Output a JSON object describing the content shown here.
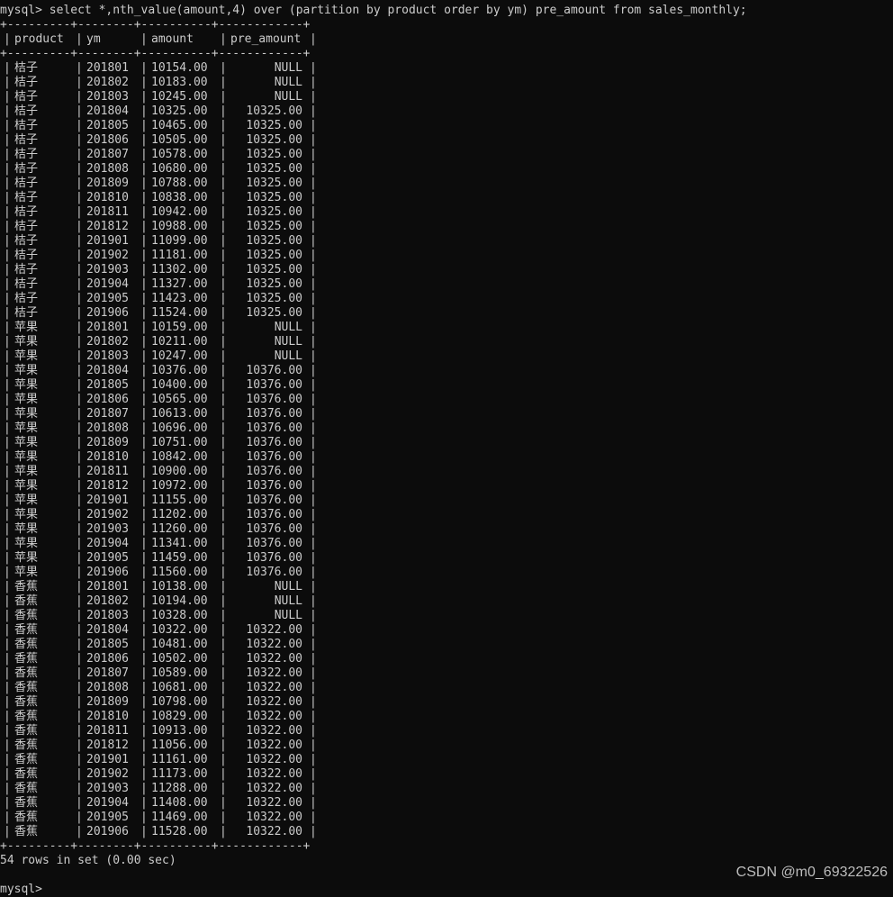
{
  "terminal": {
    "prompt": "mysql> select *,nth_value(amount,4) over (partition by product order by ym) pre_amount from sales_monthly;",
    "border": "+---------+--------+----------+------------+",
    "columns": [
      "product",
      "ym",
      "amount",
      "pre_amount"
    ],
    "rows": [
      [
        "桔子",
        "201801",
        "10154.00",
        "NULL"
      ],
      [
        "桔子",
        "201802",
        "10183.00",
        "NULL"
      ],
      [
        "桔子",
        "201803",
        "10245.00",
        "NULL"
      ],
      [
        "桔子",
        "201804",
        "10325.00",
        "10325.00"
      ],
      [
        "桔子",
        "201805",
        "10465.00",
        "10325.00"
      ],
      [
        "桔子",
        "201806",
        "10505.00",
        "10325.00"
      ],
      [
        "桔子",
        "201807",
        "10578.00",
        "10325.00"
      ],
      [
        "桔子",
        "201808",
        "10680.00",
        "10325.00"
      ],
      [
        "桔子",
        "201809",
        "10788.00",
        "10325.00"
      ],
      [
        "桔子",
        "201810",
        "10838.00",
        "10325.00"
      ],
      [
        "桔子",
        "201811",
        "10942.00",
        "10325.00"
      ],
      [
        "桔子",
        "201812",
        "10988.00",
        "10325.00"
      ],
      [
        "桔子",
        "201901",
        "11099.00",
        "10325.00"
      ],
      [
        "桔子",
        "201902",
        "11181.00",
        "10325.00"
      ],
      [
        "桔子",
        "201903",
        "11302.00",
        "10325.00"
      ],
      [
        "桔子",
        "201904",
        "11327.00",
        "10325.00"
      ],
      [
        "桔子",
        "201905",
        "11423.00",
        "10325.00"
      ],
      [
        "桔子",
        "201906",
        "11524.00",
        "10325.00"
      ],
      [
        "苹果",
        "201801",
        "10159.00",
        "NULL"
      ],
      [
        "苹果",
        "201802",
        "10211.00",
        "NULL"
      ],
      [
        "苹果",
        "201803",
        "10247.00",
        "NULL"
      ],
      [
        "苹果",
        "201804",
        "10376.00",
        "10376.00"
      ],
      [
        "苹果",
        "201805",
        "10400.00",
        "10376.00"
      ],
      [
        "苹果",
        "201806",
        "10565.00",
        "10376.00"
      ],
      [
        "苹果",
        "201807",
        "10613.00",
        "10376.00"
      ],
      [
        "苹果",
        "201808",
        "10696.00",
        "10376.00"
      ],
      [
        "苹果",
        "201809",
        "10751.00",
        "10376.00"
      ],
      [
        "苹果",
        "201810",
        "10842.00",
        "10376.00"
      ],
      [
        "苹果",
        "201811",
        "10900.00",
        "10376.00"
      ],
      [
        "苹果",
        "201812",
        "10972.00",
        "10376.00"
      ],
      [
        "苹果",
        "201901",
        "11155.00",
        "10376.00"
      ],
      [
        "苹果",
        "201902",
        "11202.00",
        "10376.00"
      ],
      [
        "苹果",
        "201903",
        "11260.00",
        "10376.00"
      ],
      [
        "苹果",
        "201904",
        "11341.00",
        "10376.00"
      ],
      [
        "苹果",
        "201905",
        "11459.00",
        "10376.00"
      ],
      [
        "苹果",
        "201906",
        "11560.00",
        "10376.00"
      ],
      [
        "香蕉",
        "201801",
        "10138.00",
        "NULL"
      ],
      [
        "香蕉",
        "201802",
        "10194.00",
        "NULL"
      ],
      [
        "香蕉",
        "201803",
        "10328.00",
        "NULL"
      ],
      [
        "香蕉",
        "201804",
        "10322.00",
        "10322.00"
      ],
      [
        "香蕉",
        "201805",
        "10481.00",
        "10322.00"
      ],
      [
        "香蕉",
        "201806",
        "10502.00",
        "10322.00"
      ],
      [
        "香蕉",
        "201807",
        "10589.00",
        "10322.00"
      ],
      [
        "香蕉",
        "201808",
        "10681.00",
        "10322.00"
      ],
      [
        "香蕉",
        "201809",
        "10798.00",
        "10322.00"
      ],
      [
        "香蕉",
        "201810",
        "10829.00",
        "10322.00"
      ],
      [
        "香蕉",
        "201811",
        "10913.00",
        "10322.00"
      ],
      [
        "香蕉",
        "201812",
        "11056.00",
        "10322.00"
      ],
      [
        "香蕉",
        "201901",
        "11161.00",
        "10322.00"
      ],
      [
        "香蕉",
        "201902",
        "11173.00",
        "10322.00"
      ],
      [
        "香蕉",
        "201903",
        "11288.00",
        "10322.00"
      ],
      [
        "香蕉",
        "201904",
        "11408.00",
        "10322.00"
      ],
      [
        "香蕉",
        "201905",
        "11469.00",
        "10322.00"
      ],
      [
        "香蕉",
        "201906",
        "11528.00",
        "10322.00"
      ]
    ],
    "summary": "54 rows in set (0.00 sec)",
    "prompt2": "mysql>"
  },
  "watermark": "CSDN @m0_69322526",
  "colors": {
    "background": "#0c0c0c",
    "text": "#cccccc"
  }
}
